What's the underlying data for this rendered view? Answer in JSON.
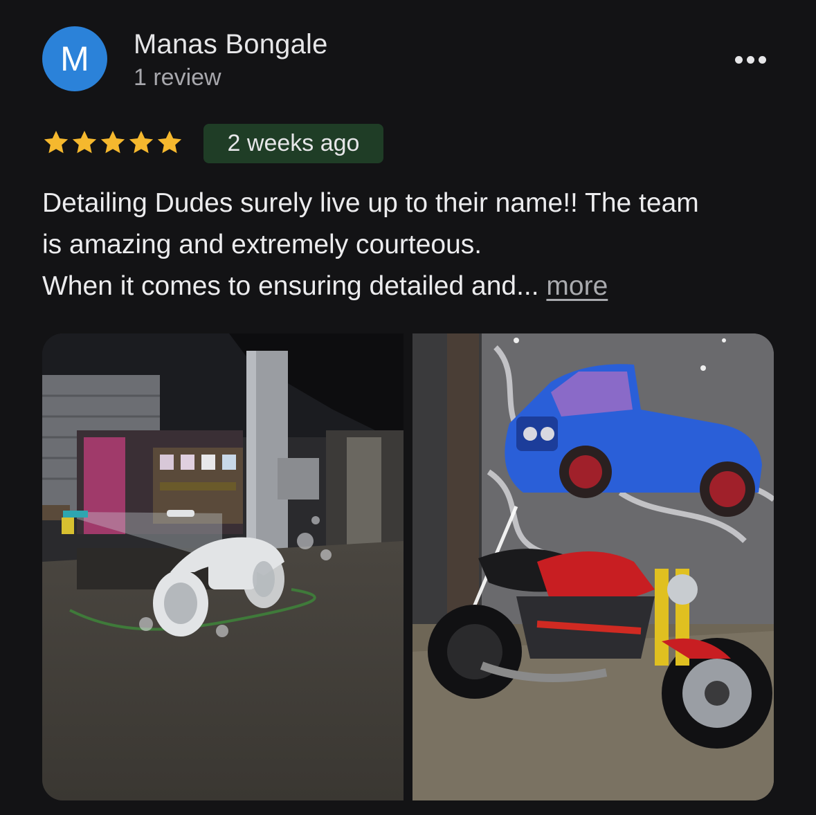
{
  "reviewer": {
    "avatar_letter": "M",
    "name": "Manas Bongale",
    "review_count": "1 review"
  },
  "rating": {
    "stars": 5,
    "max": 5
  },
  "time_ago": "2 weeks ago",
  "review": {
    "lines": [
      "Detailing Dudes surely live up to their name!! The team",
      "is amazing and extremely courteous.",
      "When it comes to ensuring detailed and... "
    ],
    "more_label": "more"
  },
  "photos": [
    {
      "name": "motorcycle-foam-wash-photo"
    },
    {
      "name": "red-motorcycle-mural-photo"
    }
  ],
  "colors": {
    "avatar": "#2b82d9",
    "star": "#f5b82e",
    "badge_bg": "#1f3d26",
    "background": "#131315"
  }
}
